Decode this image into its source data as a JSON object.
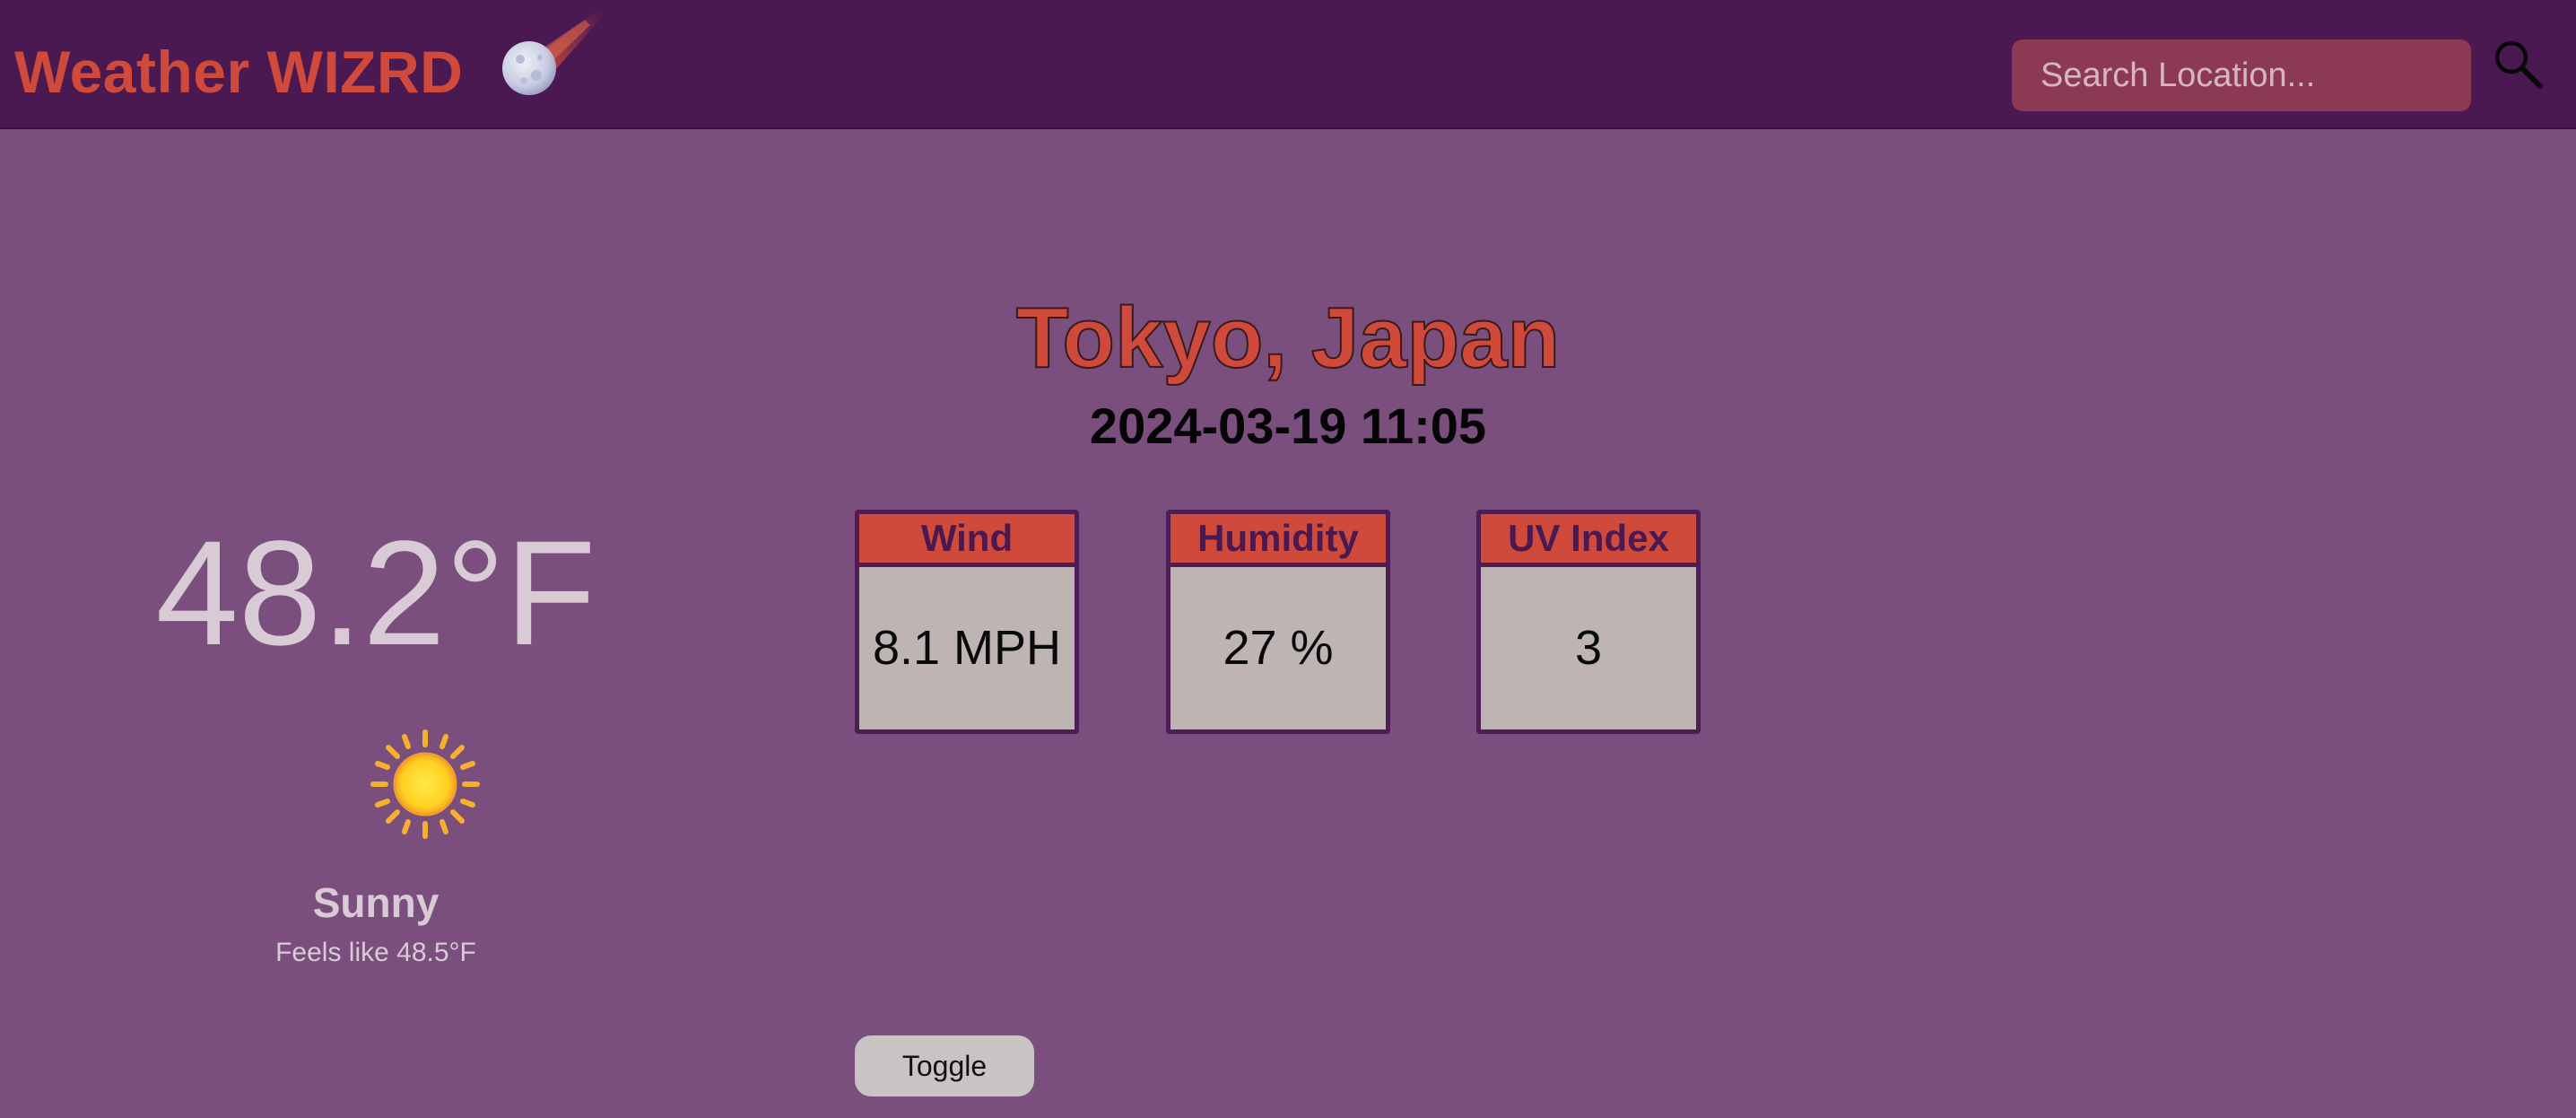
{
  "header": {
    "brand": "Weather WIZRD",
    "logo_icon": "comet-moon-icon",
    "search": {
      "placeholder": "Search Location..."
    },
    "search_icon": "magnifier-icon"
  },
  "location": {
    "city": "Tokyo, Japan",
    "datetime": "2024-03-19 11:05"
  },
  "current": {
    "temperature": "48.2°F",
    "condition_icon": "sun-icon",
    "condition": "Sunny",
    "feels_like": "Feels like 48.5°F"
  },
  "stats": [
    {
      "label": "Wind",
      "value": "8.1 MPH"
    },
    {
      "label": "Humidity",
      "value": "27 %"
    },
    {
      "label": "UV Index",
      "value": "3"
    }
  ],
  "controls": {
    "toggle_label": "Toggle"
  },
  "colors": {
    "page_bg": "#7a4f7e",
    "header_bg": "#4a1952",
    "accent": "#cf4a3a",
    "search_bg": "#8c3953",
    "card_bg": "#bdb4b3",
    "card_border": "#4e1c56"
  }
}
